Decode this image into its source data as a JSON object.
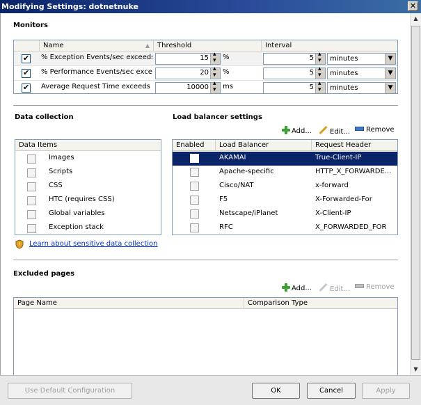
{
  "window": {
    "title": "Modifying Settings: dotnetnuke",
    "close_glyph": "✕"
  },
  "monitors": {
    "title": "Monitors",
    "columns": [
      "Name",
      "Threshold",
      "Interval"
    ],
    "rows": [
      {
        "checked": true,
        "name": "% Exception Events/sec exceeds ...",
        "threshold": "15",
        "unit": "%",
        "interval": "5",
        "interval_unit": "minutes"
      },
      {
        "checked": true,
        "name": "% Performance Events/sec excee...",
        "threshold": "20",
        "unit": "%",
        "interval": "5",
        "interval_unit": "minutes"
      },
      {
        "checked": true,
        "name": "Average Request Time exceeds t...",
        "threshold": "10000",
        "unit": "ms",
        "interval": "5",
        "interval_unit": "minutes"
      }
    ]
  },
  "data_collection": {
    "title": "Data collection",
    "header": "Data Items",
    "items": [
      "Images",
      "Scripts",
      "CSS",
      "HTC (requires CSS)",
      "Global variables",
      "Exception stack"
    ],
    "learn_link": "Learn about sensitive data collection"
  },
  "load_balancer": {
    "title": "Load balancer settings",
    "toolbar": {
      "add": "Add...",
      "edit": "Edit...",
      "remove": "Remove"
    },
    "columns": [
      "Enabled",
      "Load Balancer",
      "Request Header"
    ],
    "rows": [
      {
        "name": "AKAMAI",
        "header": "True-Client-IP",
        "selected": true
      },
      {
        "name": "Apache-specific",
        "header": "HTTP_X_FORWARDE..."
      },
      {
        "name": "Cisco/NAT",
        "header": "x-forward"
      },
      {
        "name": "F5",
        "header": "X-Forwarded-For"
      },
      {
        "name": "Netscape/iPlanet",
        "header": "X-Client-IP"
      },
      {
        "name": "RFC",
        "header": "X_FORWARDED_FOR"
      }
    ]
  },
  "excluded_pages": {
    "title": "Excluded pages",
    "toolbar": {
      "add": "Add...",
      "edit": "Edit...",
      "remove": "Remove"
    },
    "columns": [
      "Page Name",
      "Comparison Type"
    ]
  },
  "buttons": {
    "default": "Use Default Configuration",
    "ok": "OK",
    "cancel": "Cancel",
    "apply": "Apply"
  },
  "colors": {
    "titlebar": "#0a246a",
    "selection": "#0a246a",
    "link": "#0033cc"
  }
}
